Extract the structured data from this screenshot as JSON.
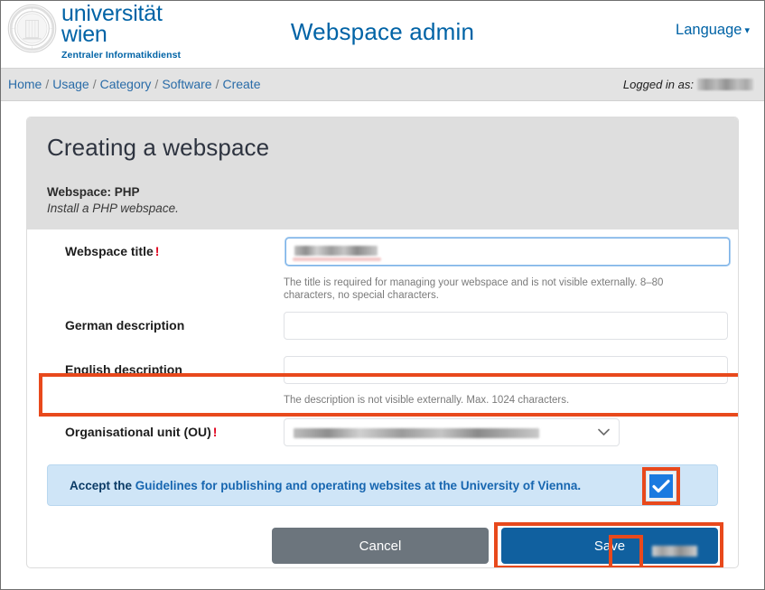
{
  "header": {
    "logo_line1": "universität",
    "logo_line2": "wien",
    "logo_sub": "Zentraler Informatikdienst",
    "app_title": "Webspace admin",
    "language_label": "Language",
    "language_caret": "▾"
  },
  "breadcrumb": {
    "separator": "/",
    "items": [
      {
        "label": "Home"
      },
      {
        "label": "Usage"
      },
      {
        "label": "Category"
      },
      {
        "label": "Software"
      },
      {
        "label": "Create"
      }
    ],
    "logged_in_label": "Logged in as:",
    "logged_in_value_redacted": true
  },
  "card": {
    "title": "Creating a webspace",
    "webspace_label": "Webspace: PHP",
    "webspace_description": "Install a PHP webspace."
  },
  "form": {
    "title_field": {
      "label": "Webspace title",
      "required_marker": "!",
      "value_redacted": true,
      "help": "The title is required for managing your webspace and is not visible externally. 8–80 characters, no special characters."
    },
    "german_description": {
      "label": "German description",
      "value": "",
      "placeholder": ""
    },
    "english_description": {
      "label": "English description",
      "value": "",
      "placeholder": "",
      "help": "The description is not visible externally. Max. 1024 characters."
    },
    "organisational_unit": {
      "label": "Organisational unit (OU)",
      "required_marker": "!",
      "value_redacted": true,
      "chevron_icon": "chevron-down-icon"
    }
  },
  "guidelines": {
    "prefix": "Accept the ",
    "link_text": "Guidelines for publishing and operating websites at the University of Vienna.",
    "checkbox_checked": true
  },
  "actions": {
    "cancel_label": "Cancel",
    "save_label": "Save"
  },
  "colors": {
    "brand_blue": "#0063a6",
    "link_blue": "#1766b0",
    "highlight_orange": "#e8491c",
    "save_blue": "#10609f",
    "cancel_grey": "#6c757d",
    "required_red": "#e0001b",
    "banner_bg": "#cfe5f7",
    "checkbox_blue": "#1a7ae0"
  }
}
